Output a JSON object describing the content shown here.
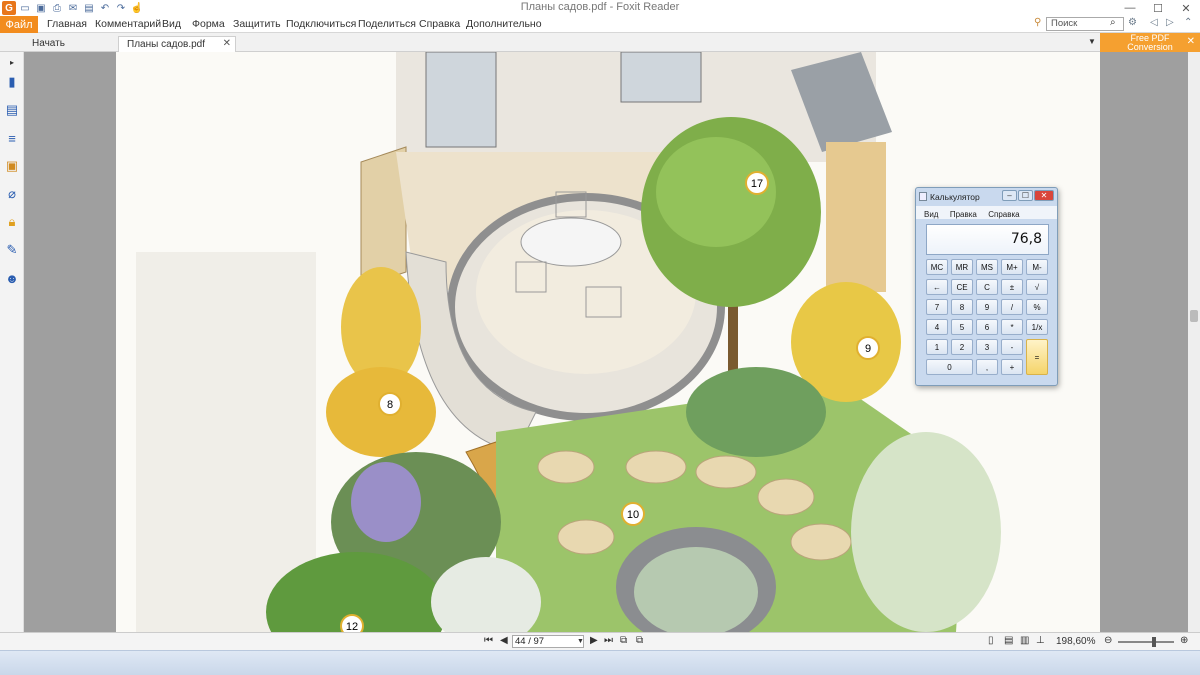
{
  "window": {
    "title": "Планы садов.pdf - Foxit Reader"
  },
  "ribbon": {
    "file_label": "Файл",
    "menu": [
      "Главная",
      "Комментарий",
      "Вид",
      "Форма",
      "Защитить",
      "Подключиться",
      "Поделиться",
      "Справка",
      "Дополнительно"
    ],
    "search_placeholder": "Поиск"
  },
  "tabs": {
    "home_label": "Начать",
    "doc_label": "Планы садов.pdf"
  },
  "promo": {
    "line1": "Free PDF",
    "line2": "Conversion"
  },
  "document": {
    "labels": [
      "17",
      "9",
      "8",
      "10",
      "12"
    ]
  },
  "calculator": {
    "title": "Калькулятор",
    "menu": [
      "Вид",
      "Правка",
      "Справка"
    ],
    "display": "76,8",
    "rows": [
      [
        "MC",
        "MR",
        "MS",
        "M+",
        "M-"
      ],
      [
        "←",
        "CE",
        "C",
        "±",
        "√"
      ],
      [
        "7",
        "8",
        "9",
        "/",
        "%"
      ],
      [
        "4",
        "5",
        "6",
        "*",
        "1/x"
      ],
      [
        "1",
        "2",
        "3",
        "-",
        ""
      ],
      [
        "0",
        "",
        ",",
        "+",
        ""
      ]
    ],
    "equals": "="
  },
  "status": {
    "page": "44 / 97",
    "zoom": "198,60%"
  }
}
